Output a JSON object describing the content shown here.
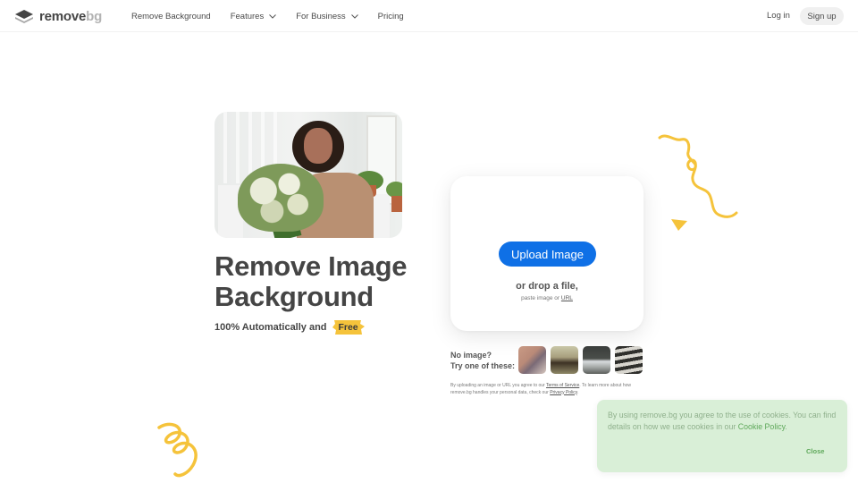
{
  "header": {
    "logo": {
      "primary": "remove",
      "secondary": "bg"
    },
    "nav": [
      {
        "label": "Remove Background",
        "has_dropdown": false
      },
      {
        "label": "Features",
        "has_dropdown": true
      },
      {
        "label": "For Business",
        "has_dropdown": true
      },
      {
        "label": "Pricing",
        "has_dropdown": false
      }
    ],
    "login_label": "Log in",
    "signup_label": "Sign up"
  },
  "hero": {
    "title_line1": "Remove Image",
    "title_line2": "Background",
    "subtitle": "100% Automatically and",
    "badge": "Free"
  },
  "upload": {
    "button_label": "Upload Image",
    "drop_text": "or drop a file,",
    "paste_text": "paste image or",
    "url_link": "URL"
  },
  "samples": {
    "line1": "No image?",
    "line2": "Try one of these:",
    "items": [
      {
        "alt": "man-in-plaid-shirt"
      },
      {
        "alt": "dog-with-stick"
      },
      {
        "alt": "white-car"
      },
      {
        "alt": "vintage-microphone"
      }
    ]
  },
  "legal": {
    "prefix": "By uploading an image or URL you agree to our",
    "tos_link": "Terms of Service",
    "middle": ". To learn more about how remove.bg handles your personal data, check our",
    "privacy_link": "Privacy Policy",
    "suffix": "."
  },
  "cookie": {
    "text": "By using remove.bg you agree to the use of cookies. You can find details on how we use cookies in our",
    "link": "Cookie Policy",
    "suffix": ".",
    "close_label": "Close"
  },
  "colors": {
    "accent_blue": "#0f70e6",
    "brand_yellow": "#f5c33b",
    "cookie_bg": "#d9efd7",
    "cookie_green": "#5ea85a",
    "text_dark": "#454545"
  }
}
